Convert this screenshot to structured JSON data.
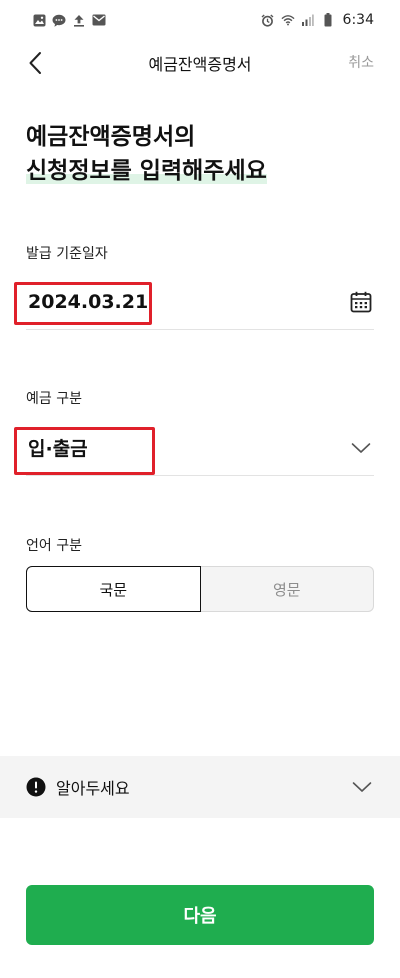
{
  "status_bar": {
    "time": "6:34",
    "left_icons": [
      "image-icon",
      "chat-bubble-icon",
      "upload-icon",
      "mail-icon"
    ],
    "right_icons": [
      "alarm-icon",
      "wifi-icon",
      "signal-icon",
      "battery-icon"
    ]
  },
  "header": {
    "title": "예금잔액증명서",
    "cancel_label": "취소"
  },
  "headline": {
    "line1": "예금잔액증명서의",
    "line2": "신청정보를 입력해주세요"
  },
  "issue_date": {
    "label": "발급 기준일자",
    "value": "2024.03.21"
  },
  "deposit_type": {
    "label": "예금 구분",
    "value": "입·출금"
  },
  "language": {
    "label": "언어 구분",
    "options": [
      "국문",
      "영문"
    ],
    "selected": "국문"
  },
  "notice": {
    "label": "알아두세요"
  },
  "next_button": {
    "label": "다음"
  },
  "colors": {
    "accent_green": "#1fad4f",
    "highlight_red": "#e0202a",
    "muted_gray": "#9a9a9a"
  }
}
